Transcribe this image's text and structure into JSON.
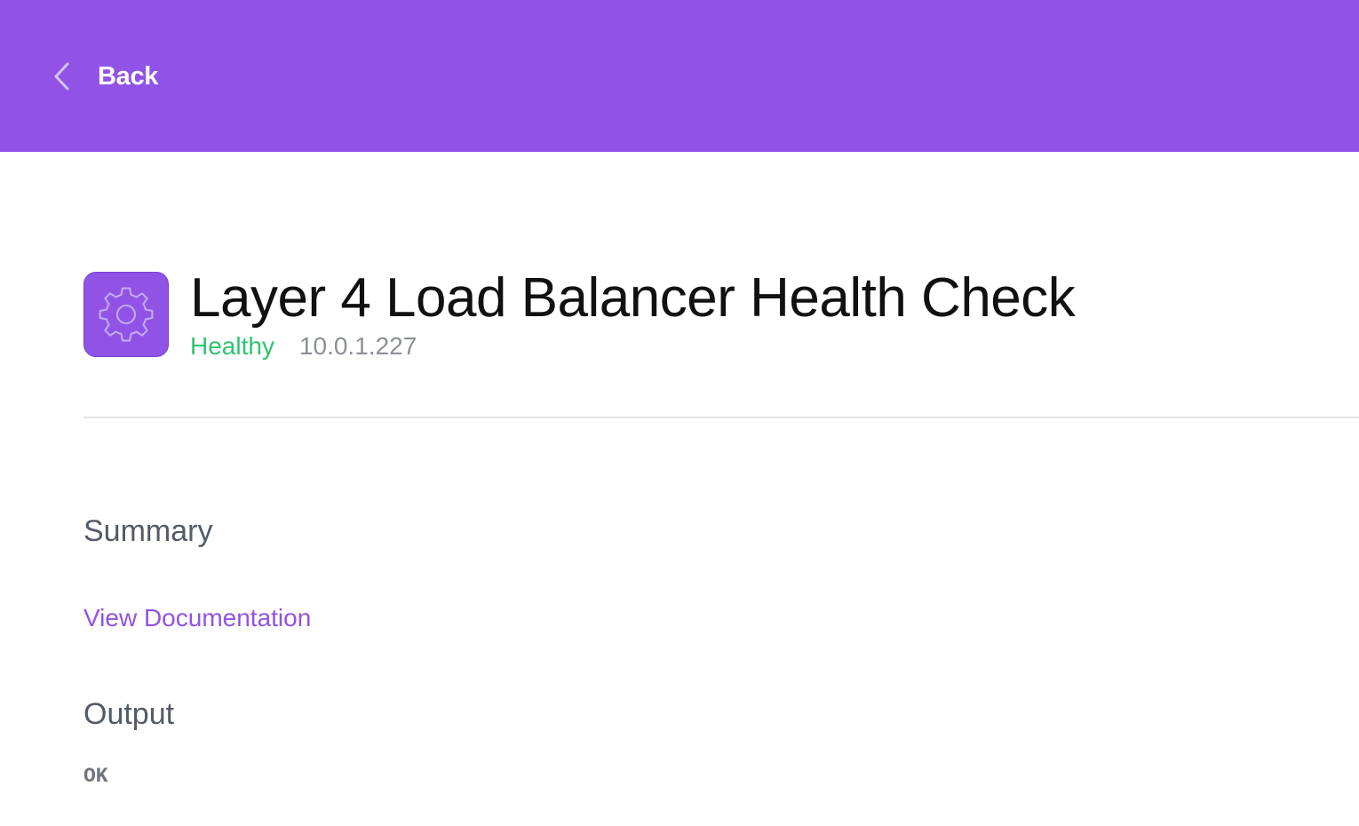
{
  "header": {
    "back_label": "Back",
    "background_color": "#9153e6",
    "back_icon": "chevron-left-icon"
  },
  "check": {
    "icon": "gear-icon",
    "title": "Layer 4 Load Balancer Health Check",
    "status": "Healthy",
    "status_color": "#2ec46e",
    "ip_address": "10.0.1.227"
  },
  "summary": {
    "heading": "Summary",
    "documentation_link": "View Documentation"
  },
  "output": {
    "heading": "Output",
    "text": "OK"
  }
}
